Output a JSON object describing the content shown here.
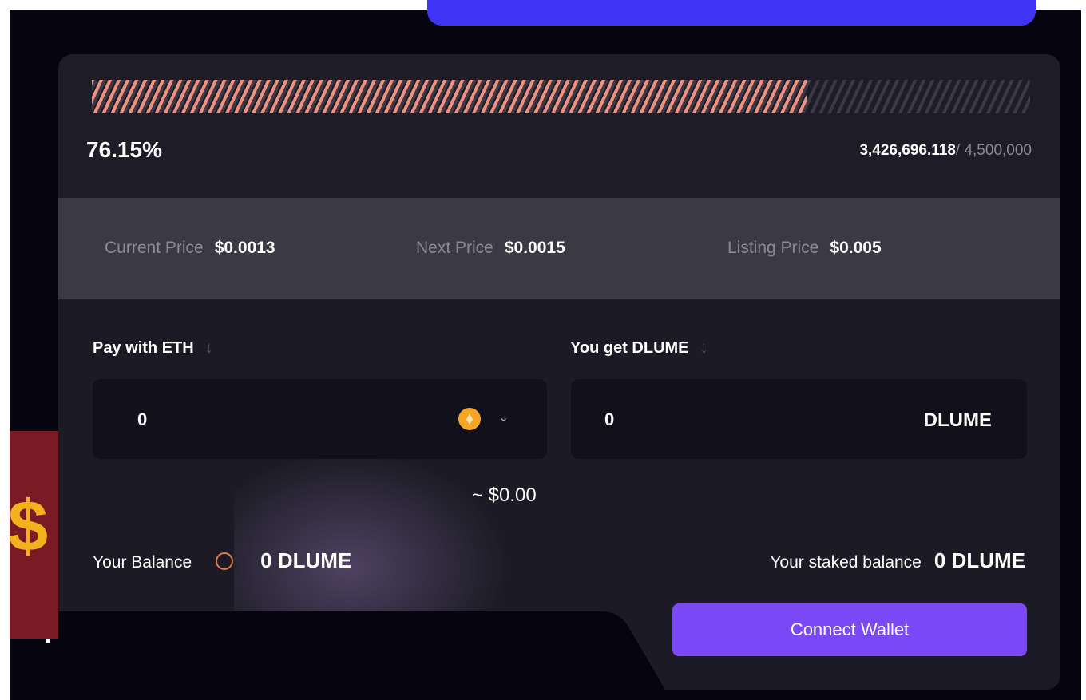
{
  "progress": {
    "percent_label": "76.15%",
    "percent": 0.7615,
    "raised": "3,426,696.118",
    "total": "/ 4,500,000"
  },
  "prices": {
    "current": {
      "label": "Current Price",
      "value": "$0.0013"
    },
    "next": {
      "label": "Next Price",
      "value": "$0.0015"
    },
    "listing": {
      "label": "Listing Price",
      "value": "$0.005"
    }
  },
  "form": {
    "pay_label": "Pay with ETH",
    "get_label": "You get DLUME",
    "pay_value": "0",
    "get_value": "0",
    "get_unit": "DLUME",
    "usd_estimate": "~ $0.00",
    "balance_label": "Your Balance",
    "balance_value": "0 DLUME",
    "staked_label": "Your staked balance",
    "staked_value": "0 DLUME",
    "cta": "Connect Wallet"
  },
  "icons": {
    "eth": "ethereum-coin-icon",
    "arrow": "arrow-down-icon",
    "chevron": "chevron-down-icon",
    "balance": "coin-outline-icon"
  },
  "colors": {
    "accent": "#7b48f5",
    "progress": "#f0907e",
    "top_button": "#3d34f5",
    "eth": "#f6a623"
  }
}
